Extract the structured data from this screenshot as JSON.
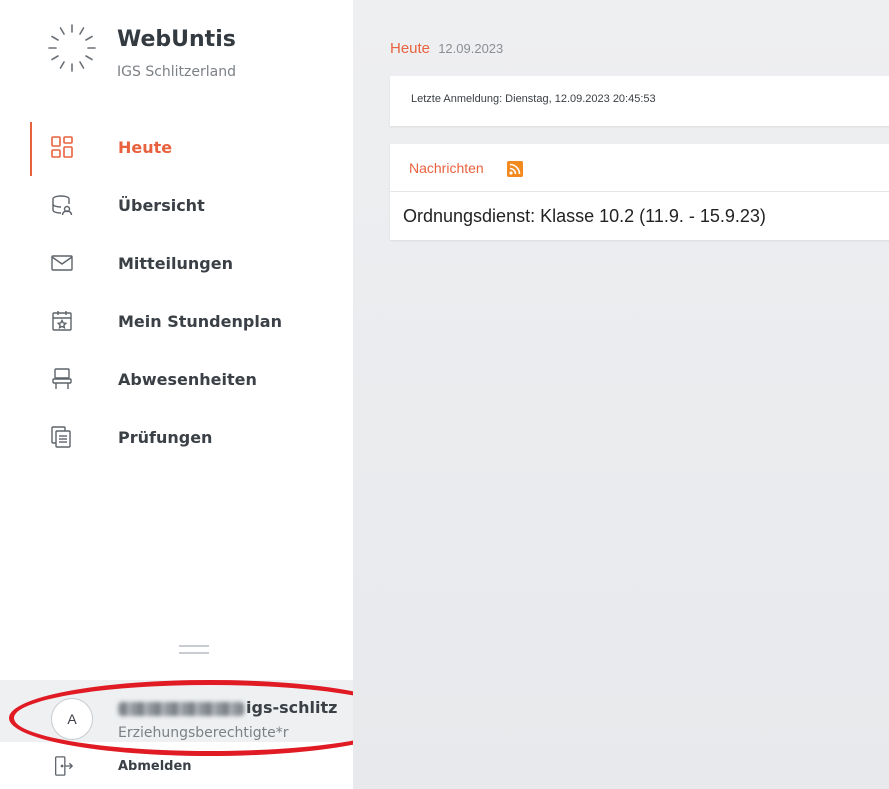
{
  "app": {
    "title": "WebUntis",
    "school": "IGS Schlitzerland"
  },
  "sidebar": {
    "items": [
      {
        "label": "Heute",
        "icon": "dashboard-icon",
        "active": true
      },
      {
        "label": "Übersicht",
        "icon": "overview-icon",
        "active": false
      },
      {
        "label": "Mitteilungen",
        "icon": "envelope-icon",
        "active": false
      },
      {
        "label": "Mein Stundenplan",
        "icon": "calendar-star-icon",
        "active": false
      },
      {
        "label": "Abwesenheiten",
        "icon": "chair-icon",
        "active": false
      },
      {
        "label": "Prüfungen",
        "icon": "exams-icon",
        "active": false
      }
    ],
    "user": {
      "avatar_letter": "A",
      "name_visible": "igs-schlitz",
      "role": "Erziehungsberechtigte*r"
    },
    "logout_label": "Abmelden"
  },
  "main": {
    "breadcrumb_title": "Heute",
    "breadcrumb_date": "12.09.2023",
    "last_login": "Letzte Anmeldung: Dienstag, 12.09.2023 20:45:53",
    "news_title": "Nachrichten",
    "news_items": [
      "Ordnungsdienst: Klasse 10.2 (11.9. - 15.9.23)"
    ]
  },
  "colors": {
    "accent": "#e9623f",
    "highlight": "#e01b24",
    "rss": "#f28a1e"
  }
}
